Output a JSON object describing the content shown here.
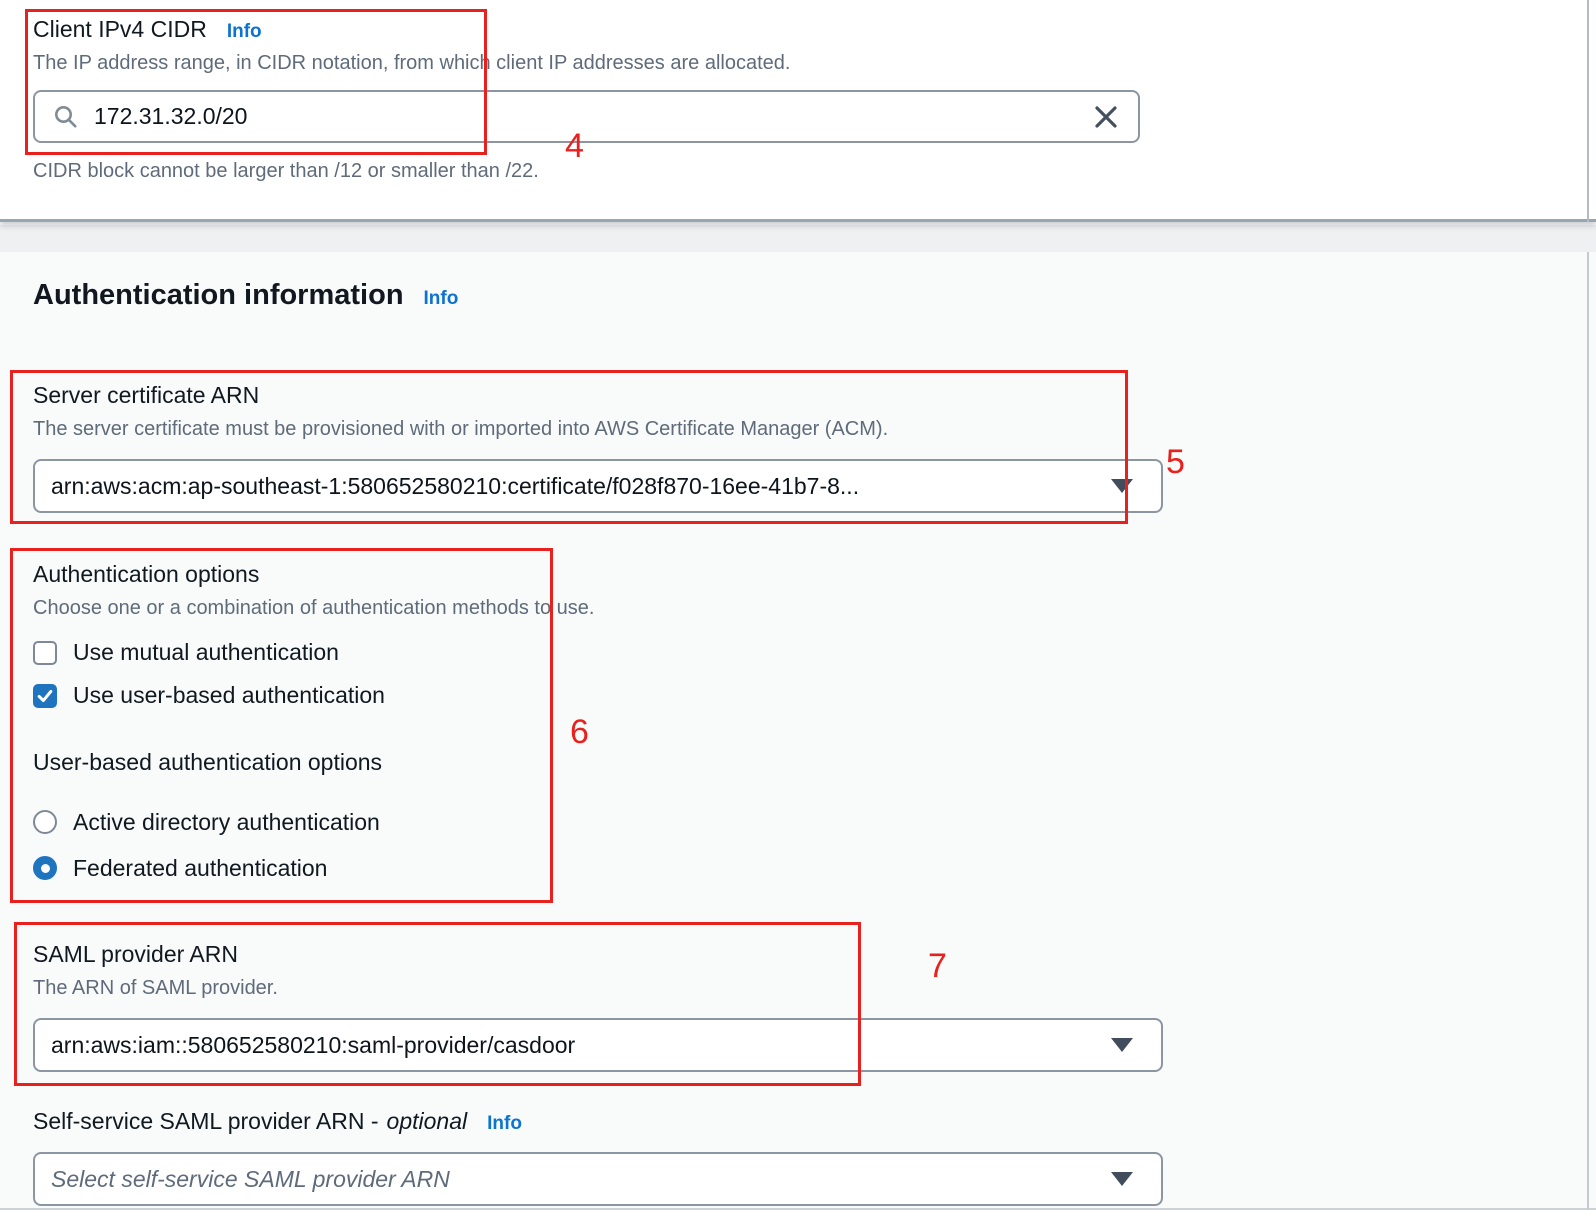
{
  "client_cidr": {
    "label": "Client IPv4 CIDR",
    "info_label": "Info",
    "description": "The IP address range, in CIDR notation, from which client IP addresses are allocated.",
    "input_value": "172.31.32.0/20",
    "constraint": "CIDR block cannot be larger than /12 or smaller than /22."
  },
  "auth_section": {
    "heading": "Authentication information",
    "info_label": "Info",
    "server_certificate": {
      "label": "Server certificate ARN",
      "description": "The server certificate must be provisioned with or imported into AWS Certificate Manager (ACM).",
      "value": "arn:aws:acm:ap-southeast-1:580652580210:certificate/f028f870-16ee-41b7-8..."
    },
    "auth_options": {
      "label": "Authentication options",
      "description": "Choose one or a combination of authentication methods to use.",
      "checkboxes": [
        {
          "label": "Use mutual authentication",
          "checked": false
        },
        {
          "label": "Use user-based authentication",
          "checked": true
        }
      ]
    },
    "user_based_options": {
      "label": "User-based authentication options",
      "radios": [
        {
          "label": "Active directory authentication",
          "checked": false
        },
        {
          "label": "Federated authentication",
          "checked": true
        }
      ]
    },
    "saml_provider": {
      "label": "SAML provider ARN",
      "description": "The ARN of SAML provider.",
      "value": "arn:aws:iam::580652580210:saml-provider/casdoor"
    },
    "self_service_saml": {
      "label": "Self-service SAML provider ARN -",
      "optional_label": "optional",
      "info_label": "Info",
      "placeholder": "Select self-service SAML provider ARN"
    }
  },
  "annotations": {
    "num4": "4",
    "num5": "5",
    "num6": "6",
    "num7": "7",
    "box_color": "#e8201e"
  },
  "colors": {
    "link_blue": "#0d72d0",
    "control_blue": "#1f74c0",
    "border_gray": "#8c96a2",
    "text_dark": "#101820",
    "text_muted": "#5f6b7a"
  }
}
